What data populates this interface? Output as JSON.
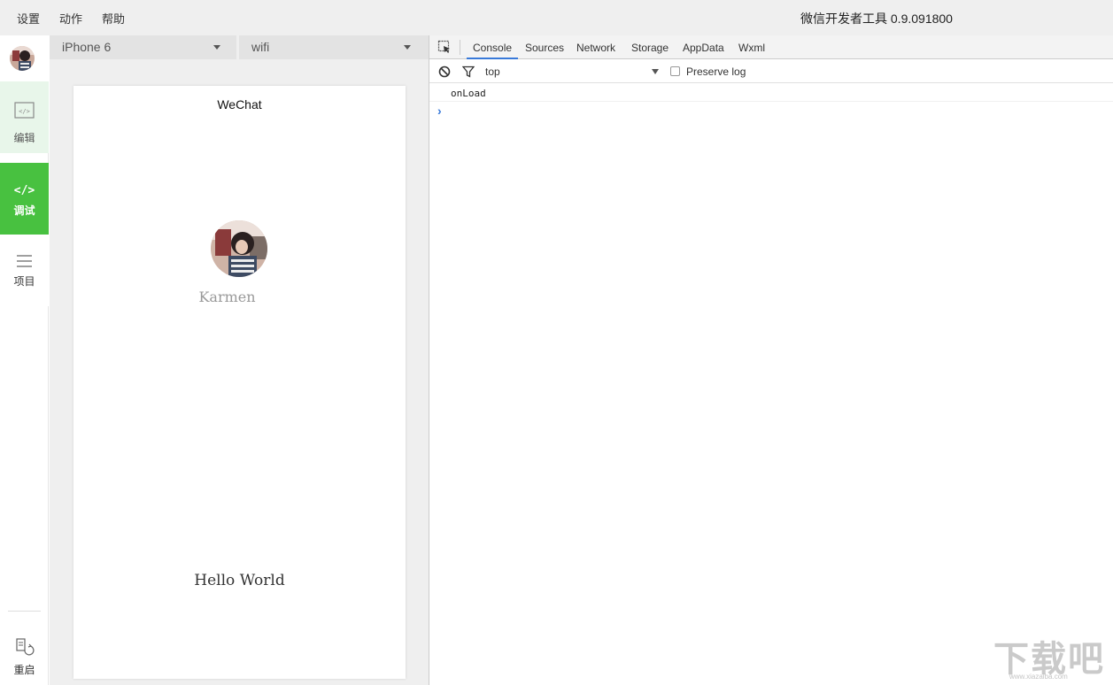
{
  "menubar": {
    "items": [
      "设置",
      "动作",
      "帮助"
    ],
    "app_title": "微信开发者工具 0.9.091800"
  },
  "leftnav": {
    "edit_label": "编辑",
    "debug_label": "调试",
    "project_label": "项目",
    "restart_label": "重启",
    "active_color": "#48c140"
  },
  "simulator": {
    "device": "iPhone 6",
    "network": "wifi",
    "page_title": "WeChat",
    "user_name": "Karmen",
    "hello_text": "Hello World"
  },
  "devtools": {
    "tabs": [
      "Console",
      "Sources",
      "Network",
      "Storage",
      "AppData",
      "Wxml"
    ],
    "active_tab": "Console",
    "context": "top",
    "preserve_log_label": "Preserve log",
    "log_lines": [
      "onLoad"
    ],
    "accent_color": "#3879d9"
  },
  "watermark": {
    "text": "下载吧",
    "url": "www.xiazaiba.com"
  }
}
